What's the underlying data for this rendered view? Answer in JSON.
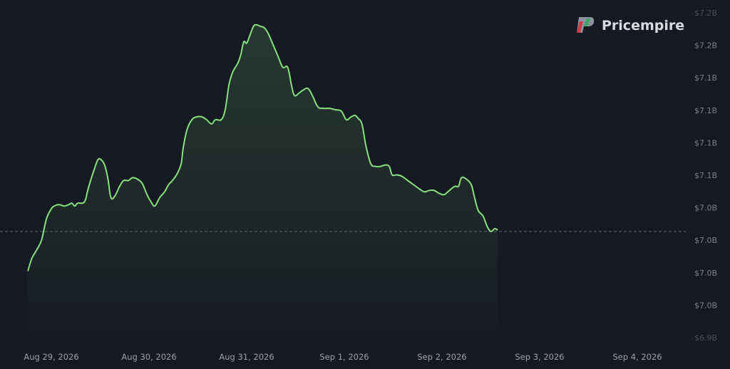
{
  "brand": {
    "name": "Pricempire",
    "icon": "pricempire-logo-icon"
  },
  "colors": {
    "background": "#151922",
    "line": "#86e07e",
    "reference_line": "#5a6b6a",
    "logo_red": "#d23b4a",
    "logo_green": "#3aa56a",
    "logo_gray": "#9aa0aa"
  },
  "chart_data": {
    "type": "area",
    "title": "",
    "xlabel": "",
    "ylabel": "",
    "y_tick_labels": [
      "$7.2B",
      "$7.2B",
      "$7.1B",
      "$7.1B",
      "$7.1B",
      "$7.1B",
      "$7.0B",
      "$7.0B",
      "$7.0B",
      "$7.0B",
      "$6.9B"
    ],
    "x_tick_labels": [
      "Aug 29, 2026",
      "Aug 30, 2026",
      "Aug 31, 2026",
      "Sep 1, 2026",
      "Sep 2, 2026",
      "Sep 3, 2026",
      "Sep 4, 2026"
    ],
    "ylim": [
      6.99,
      7.22
    ],
    "reference_value": 7.064,
    "grid": false,
    "legend": "none",
    "x_start_day": -0.24,
    "x_end_day": 6.55,
    "series": [
      {
        "points": [
          [
            -0.24,
            7.036
          ],
          [
            -0.2,
            7.045
          ],
          [
            -0.15,
            7.051
          ],
          [
            -0.1,
            7.058
          ],
          [
            -0.05,
            7.073
          ],
          [
            0.0,
            7.08
          ],
          [
            0.03,
            7.082
          ],
          [
            0.08,
            7.083
          ],
          [
            0.13,
            7.082
          ],
          [
            0.18,
            7.083
          ],
          [
            0.21,
            7.084
          ],
          [
            0.24,
            7.082
          ],
          [
            0.27,
            7.084
          ],
          [
            0.34,
            7.085
          ],
          [
            0.38,
            7.095
          ],
          [
            0.44,
            7.108
          ],
          [
            0.48,
            7.115
          ],
          [
            0.52,
            7.114
          ],
          [
            0.55,
            7.11
          ],
          [
            0.58,
            7.101
          ],
          [
            0.61,
            7.088
          ],
          [
            0.65,
            7.089
          ],
          [
            0.7,
            7.096
          ],
          [
            0.74,
            7.1
          ],
          [
            0.79,
            7.1
          ],
          [
            0.83,
            7.102
          ],
          [
            0.88,
            7.101
          ],
          [
            0.93,
            7.098
          ],
          [
            0.98,
            7.09
          ],
          [
            1.02,
            7.085
          ],
          [
            1.06,
            7.082
          ],
          [
            1.11,
            7.088
          ],
          [
            1.16,
            7.092
          ],
          [
            1.2,
            7.097
          ],
          [
            1.24,
            7.1
          ],
          [
            1.29,
            7.105
          ],
          [
            1.33,
            7.112
          ],
          [
            1.35,
            7.123
          ],
          [
            1.39,
            7.136
          ],
          [
            1.44,
            7.143
          ],
          [
            1.49,
            7.145
          ],
          [
            1.54,
            7.145
          ],
          [
            1.59,
            7.143
          ],
          [
            1.64,
            7.14
          ],
          [
            1.68,
            7.143
          ],
          [
            1.74,
            7.143
          ],
          [
            1.78,
            7.15
          ],
          [
            1.82,
            7.168
          ],
          [
            1.86,
            7.177
          ],
          [
            1.91,
            7.183
          ],
          [
            1.94,
            7.189
          ],
          [
            1.97,
            7.198
          ],
          [
            2.0,
            7.197
          ],
          [
            2.03,
            7.202
          ],
          [
            2.07,
            7.209
          ],
          [
            2.1,
            7.21
          ],
          [
            2.14,
            7.209
          ],
          [
            2.18,
            7.208
          ],
          [
            2.22,
            7.204
          ],
          [
            2.27,
            7.196
          ],
          [
            2.32,
            7.188
          ],
          [
            2.37,
            7.18
          ],
          [
            2.42,
            7.18
          ],
          [
            2.46,
            7.167
          ],
          [
            2.49,
            7.16
          ],
          [
            2.54,
            7.162
          ],
          [
            2.58,
            7.164
          ],
          [
            2.63,
            7.165
          ],
          [
            2.68,
            7.159
          ],
          [
            2.73,
            7.152
          ],
          [
            2.79,
            7.151
          ],
          [
            2.85,
            7.151
          ],
          [
            2.91,
            7.15
          ],
          [
            2.97,
            7.149
          ],
          [
            3.02,
            7.143
          ],
          [
            3.07,
            7.145
          ],
          [
            3.11,
            7.146
          ],
          [
            3.14,
            7.144
          ],
          [
            3.18,
            7.14
          ],
          [
            3.22,
            7.125
          ],
          [
            3.27,
            7.112
          ],
          [
            3.32,
            7.11
          ],
          [
            3.37,
            7.11
          ],
          [
            3.42,
            7.111
          ],
          [
            3.46,
            7.11
          ],
          [
            3.49,
            7.104
          ],
          [
            3.54,
            7.104
          ],
          [
            3.59,
            7.103
          ],
          [
            3.65,
            7.1
          ],
          [
            3.71,
            7.097
          ],
          [
            3.77,
            7.094
          ],
          [
            3.82,
            7.092
          ],
          [
            3.87,
            7.093
          ],
          [
            3.92,
            7.093
          ],
          [
            3.97,
            7.091
          ],
          [
            4.02,
            7.09
          ],
          [
            4.06,
            7.092
          ],
          [
            4.11,
            7.095
          ],
          [
            4.14,
            7.096
          ],
          [
            4.17,
            7.096
          ],
          [
            4.2,
            7.102
          ],
          [
            4.25,
            7.101
          ],
          [
            4.3,
            7.097
          ],
          [
            4.33,
            7.089
          ],
          [
            4.37,
            7.079
          ],
          [
            4.42,
            7.075
          ],
          [
            4.46,
            7.068
          ],
          [
            4.5,
            7.064
          ],
          [
            4.54,
            7.066
          ],
          [
            4.57,
            7.065
          ]
        ]
      }
    ]
  }
}
